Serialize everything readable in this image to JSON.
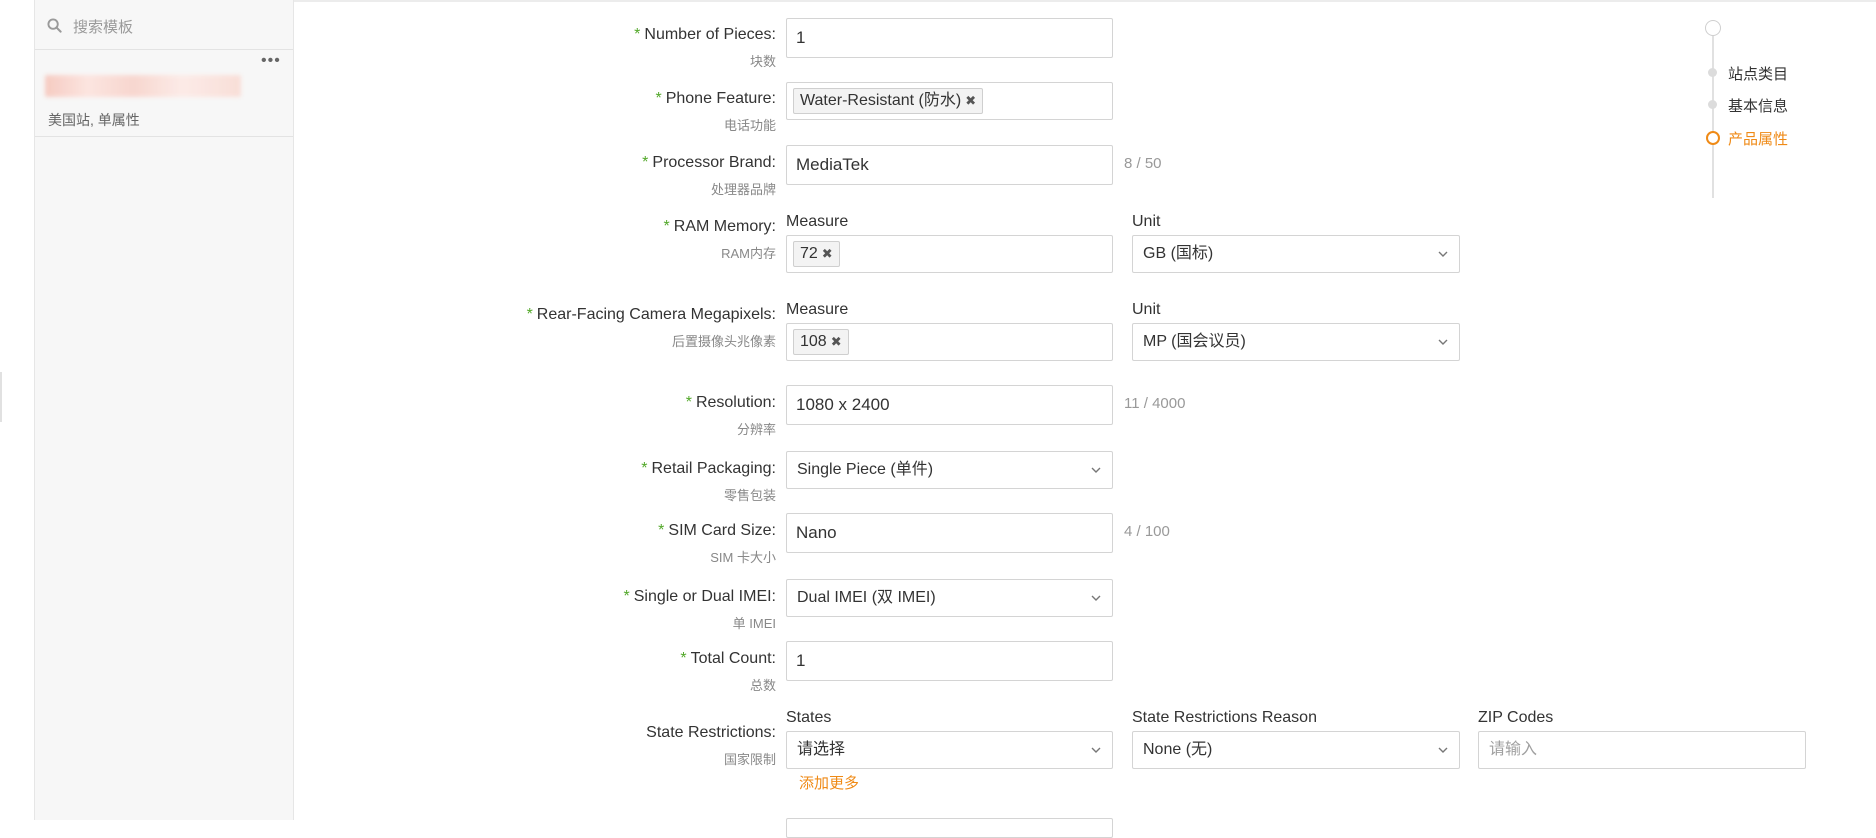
{
  "sidebar": {
    "search_placeholder": "搜索模板",
    "template": {
      "subtitle": "美国站, 单属性"
    }
  },
  "steps": [
    {
      "label": "站点类目",
      "active": false
    },
    {
      "label": "基本信息",
      "active": false
    },
    {
      "label": "产品属性",
      "active": true
    }
  ],
  "form": {
    "number_of_pieces": {
      "label": "Number of Pieces:",
      "sub": "块数",
      "value": "1"
    },
    "phone_feature": {
      "label": "Phone Feature:",
      "sub": "电话功能",
      "tag": "Water-Resistant (防水)"
    },
    "processor_brand": {
      "label": "Processor Brand:",
      "sub": "处理器品牌",
      "value": "MediaTek",
      "counter": "8 / 50"
    },
    "ram_memory": {
      "label": "RAM Memory:",
      "sub": "RAM内存",
      "measure_head": "Measure",
      "unit_head": "Unit",
      "measure_tag": "72",
      "unit": "GB (国标)"
    },
    "rear_camera": {
      "label": "Rear-Facing Camera Megapixels:",
      "sub": "后置摄像头兆像素",
      "measure_head": "Measure",
      "unit_head": "Unit",
      "measure_tag": "108",
      "unit": "MP (国会议员)"
    },
    "resolution": {
      "label": "Resolution:",
      "sub": "分辨率",
      "value": "1080 x 2400",
      "counter": "11 / 4000"
    },
    "retail_packaging": {
      "label": "Retail Packaging:",
      "sub": "零售包装",
      "value": "Single Piece (单件)"
    },
    "sim_card_size": {
      "label": "SIM Card Size:",
      "sub": "SIM 卡大小",
      "value": "Nano",
      "counter": "4 / 100"
    },
    "imei": {
      "label": "Single or Dual IMEI:",
      "sub": "单 IMEI",
      "value": "Dual IMEI (双 IMEI)"
    },
    "total_count": {
      "label": "Total Count:",
      "sub": "总数",
      "value": "1"
    },
    "state_restrictions": {
      "label": "State Restrictions:",
      "sub": "国家限制",
      "states_head": "States",
      "reason_head": "State Restrictions Reason",
      "zip_head": "ZIP Codes",
      "states_value": "请选择",
      "reason_value": "None (无)",
      "zip_placeholder": "请输入",
      "add_more": "添加更多"
    }
  },
  "colors": {
    "accent": "#ef8a16",
    "required": "#52a829",
    "border": "#d4d4d4"
  }
}
